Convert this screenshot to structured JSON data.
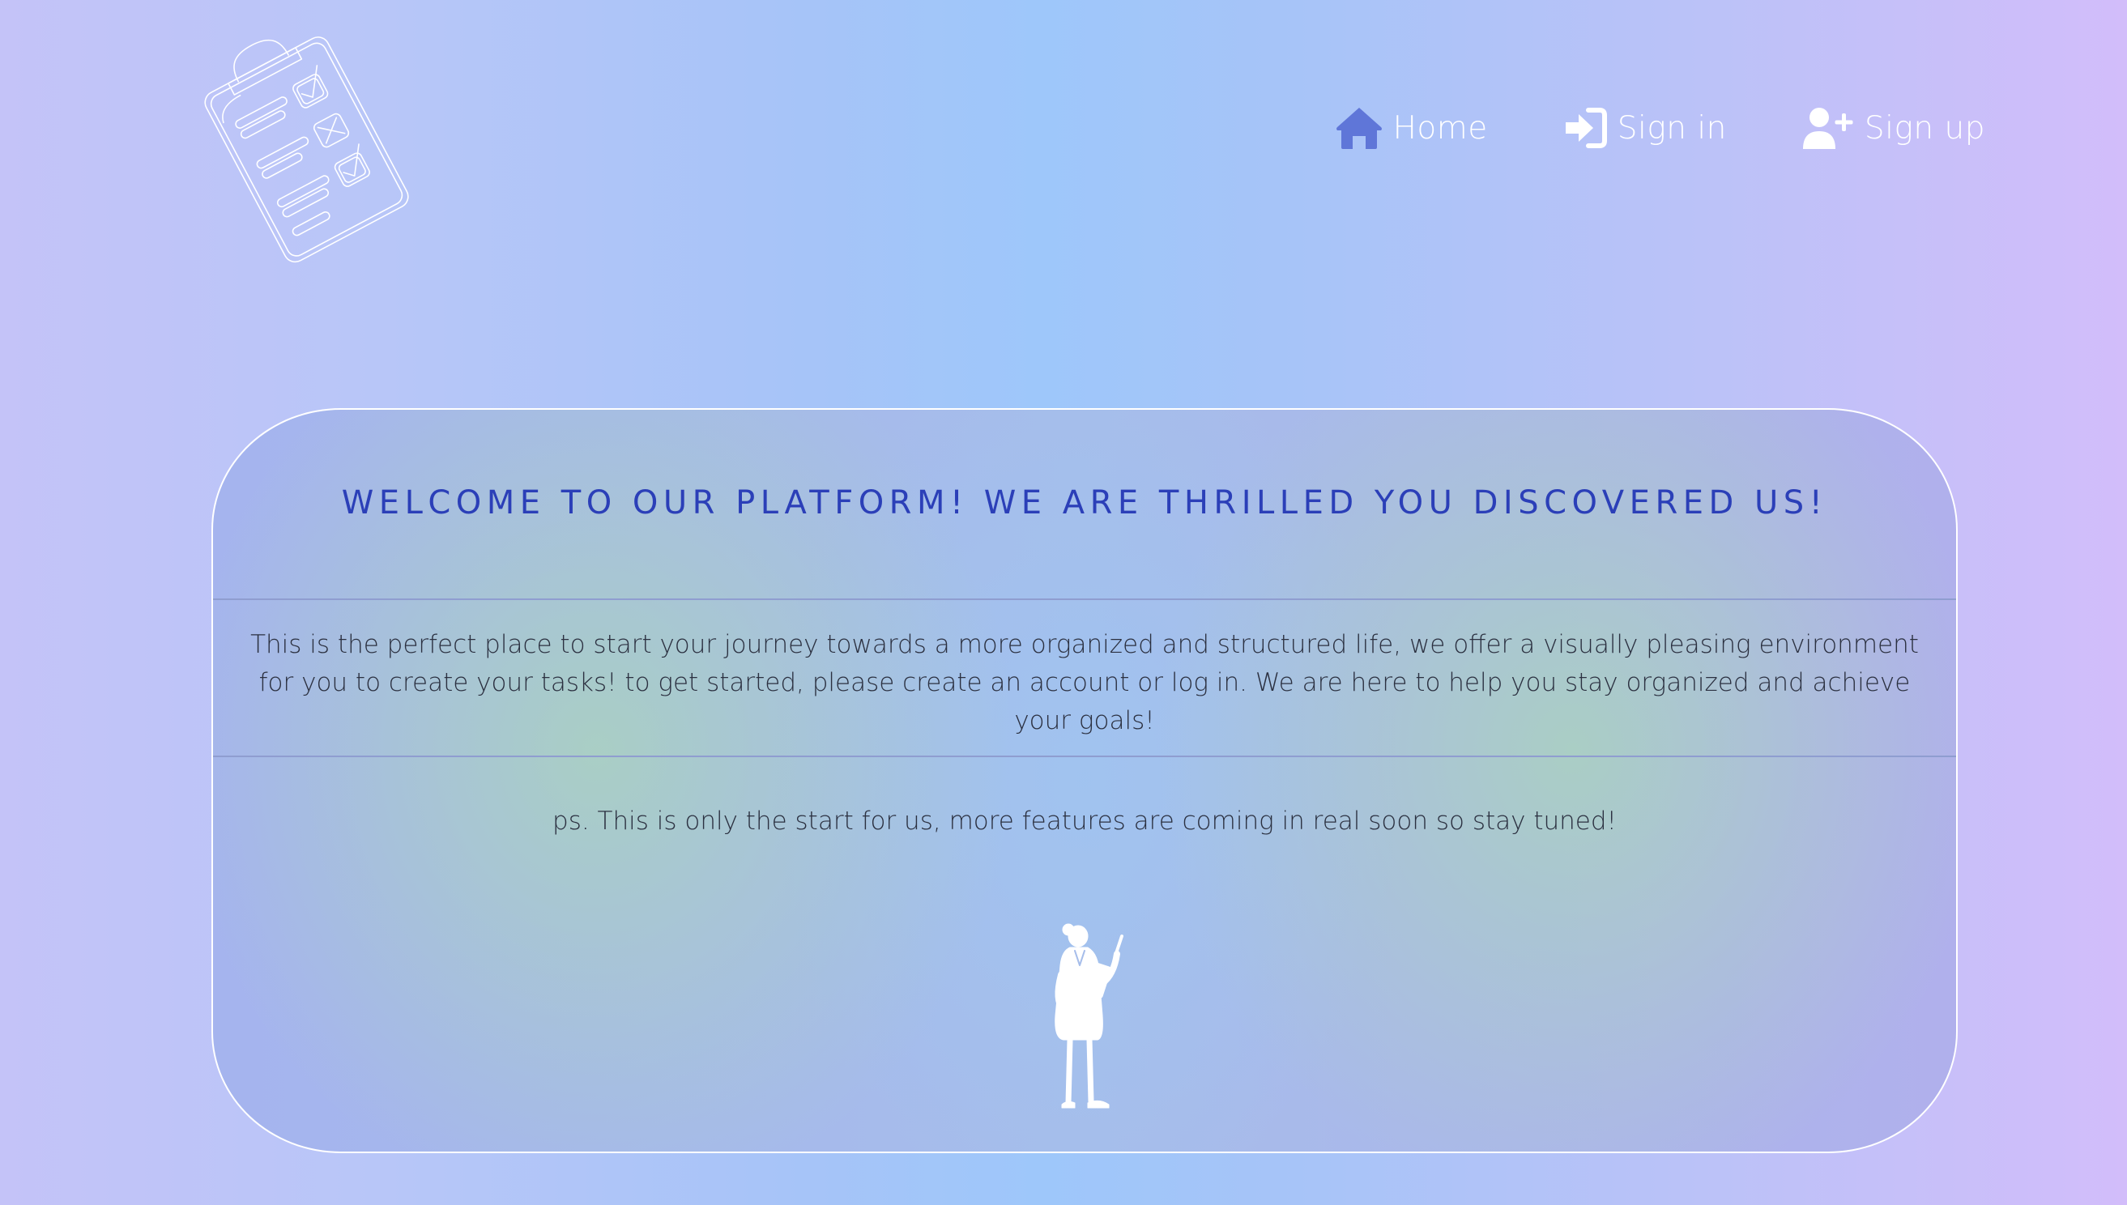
{
  "header": {
    "logo_icon": "clipboard-checklist-icon",
    "nav": [
      {
        "label": "Home",
        "icon": "home-icon"
      },
      {
        "label": "Sign in",
        "icon": "sign-in-icon"
      },
      {
        "label": "Sign up",
        "icon": "user-plus-icon"
      }
    ]
  },
  "card": {
    "title": "WELCOME TO OUR PLATFORM! WE ARE THRILLED YOU DISCOVERED US!",
    "body": "This is the perfect place to start your journey towards a more organized and structured life, we offer a visually pleasing environment for you to create your tasks! to get started, please create an account or log in. We are here to help you stay organized and achieve your goals!",
    "ps": "ps. This is only the start for us, more features are coming in real soon so stay tuned!",
    "illustration": "woman-with-clipboard-illustration"
  },
  "colors": {
    "title": "#2b3fb8",
    "body_text": "#2b3040",
    "home_icon": "#5f76d8",
    "nav_text": "#ffffff",
    "card_border": "#ffffff",
    "divider": "#8f9dd0"
  }
}
